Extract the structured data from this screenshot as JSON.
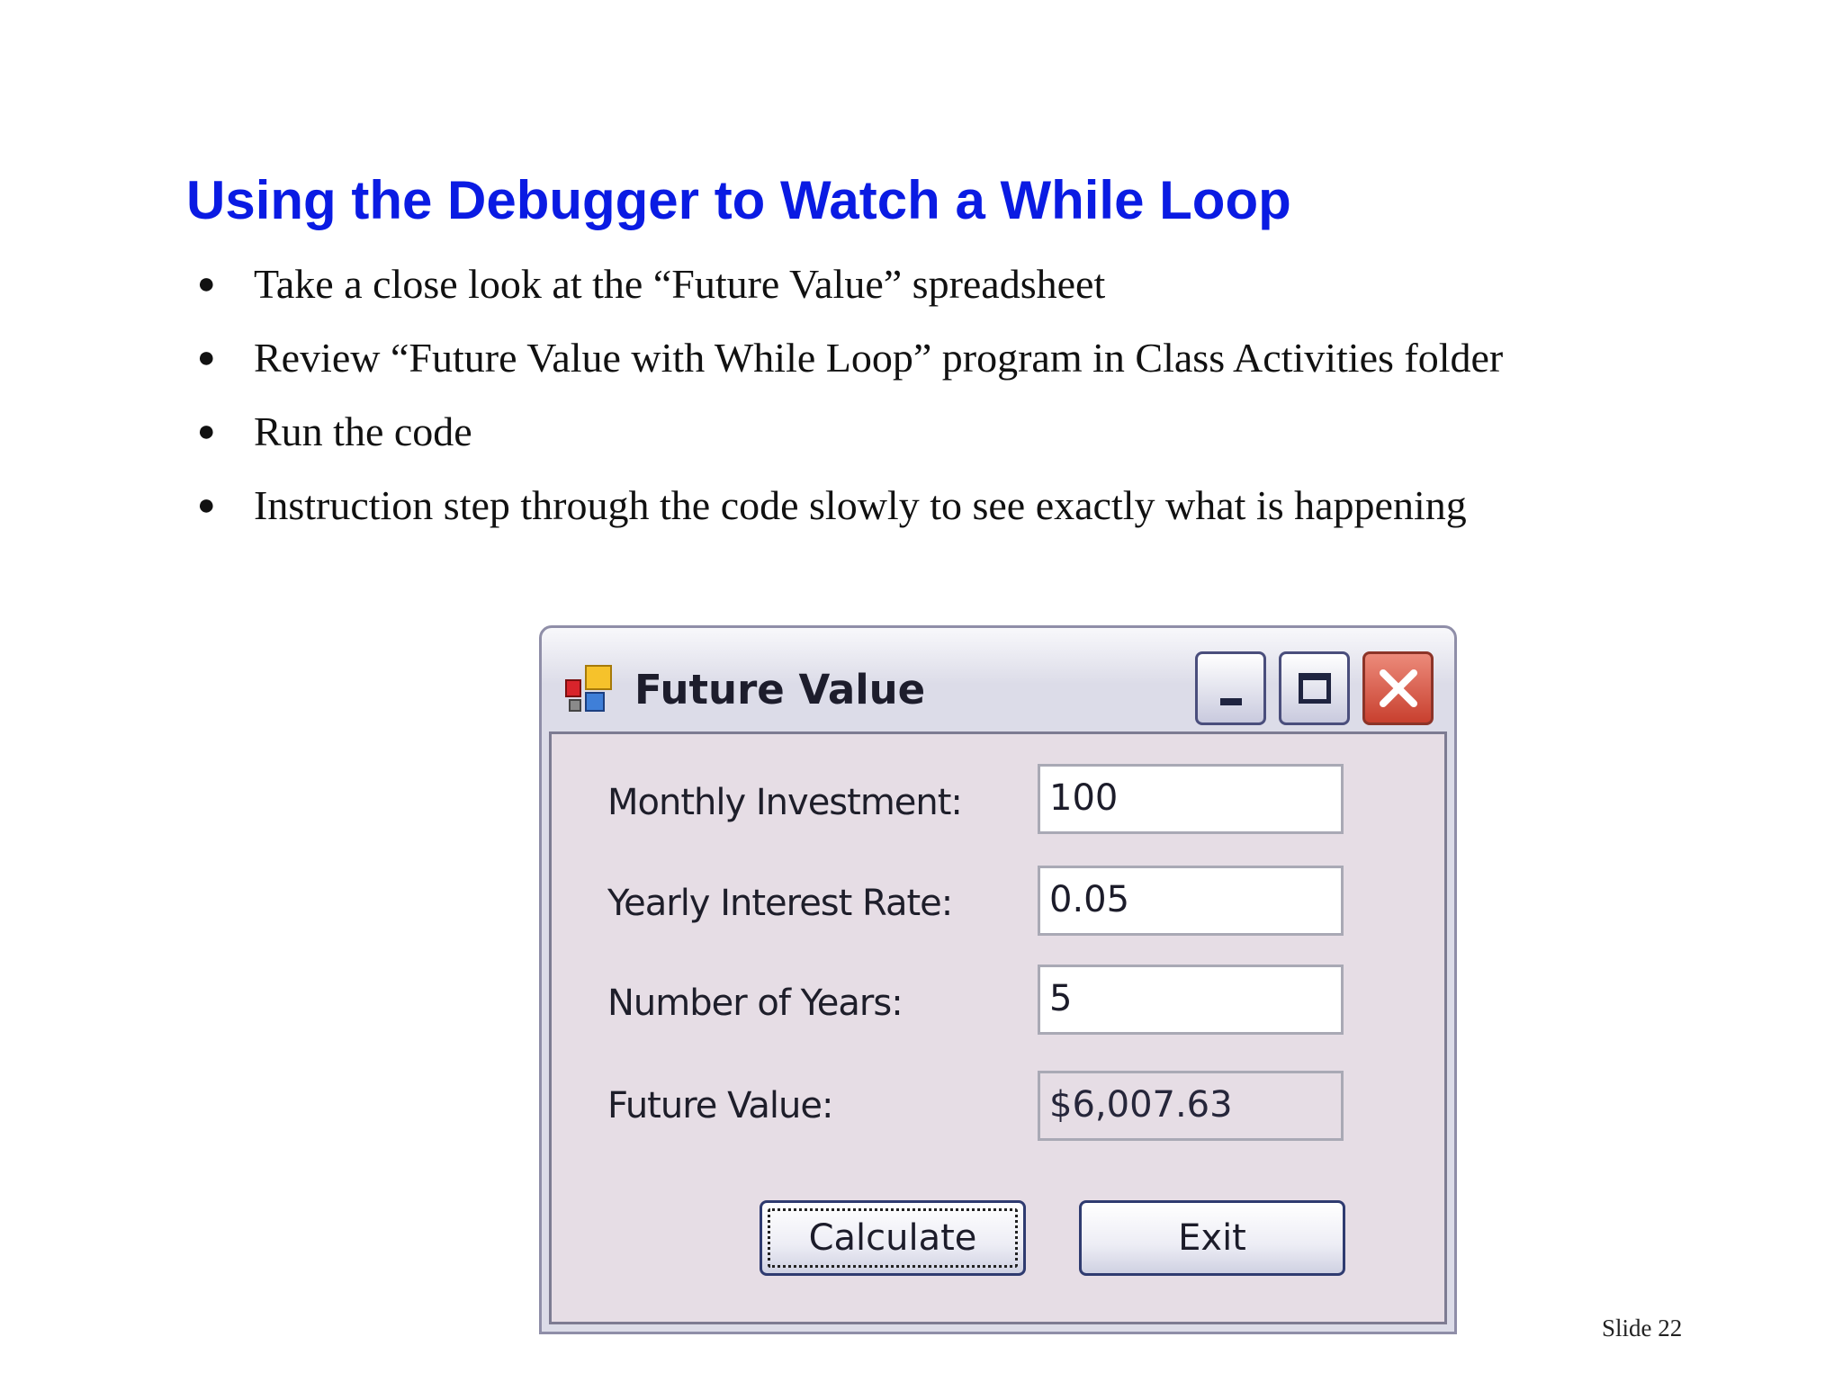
{
  "slide": {
    "title": "Using the Debugger to Watch a While Loop",
    "bullets": [
      "Take a close look at the “Future Value” spreadsheet",
      "Review “Future Value with While Loop” program in Class Activities folder",
      "Run the code",
      "Instruction step through the code slowly to see exactly what is happening"
    ],
    "slide_number": "Slide 22"
  },
  "window": {
    "title": "Future Value",
    "icon": "form-app-icon",
    "controls": {
      "minimize": "minimize-icon",
      "maximize": "maximize-icon",
      "close": "close-icon"
    },
    "fields": {
      "monthly_investment": {
        "label": "Monthly Investment:",
        "value": "100"
      },
      "yearly_interest_rate": {
        "label": "Yearly Interest Rate:",
        "value": "0.05"
      },
      "number_of_years": {
        "label": "Number of Years:",
        "value": "5"
      },
      "future_value": {
        "label": "Future Value:",
        "value": "$6,007.63"
      }
    },
    "buttons": {
      "calculate": "Calculate",
      "exit": "Exit"
    }
  },
  "colors": {
    "title": "#0a1be3",
    "window_client": "#e6dde5",
    "close_button": "#c8402f"
  }
}
